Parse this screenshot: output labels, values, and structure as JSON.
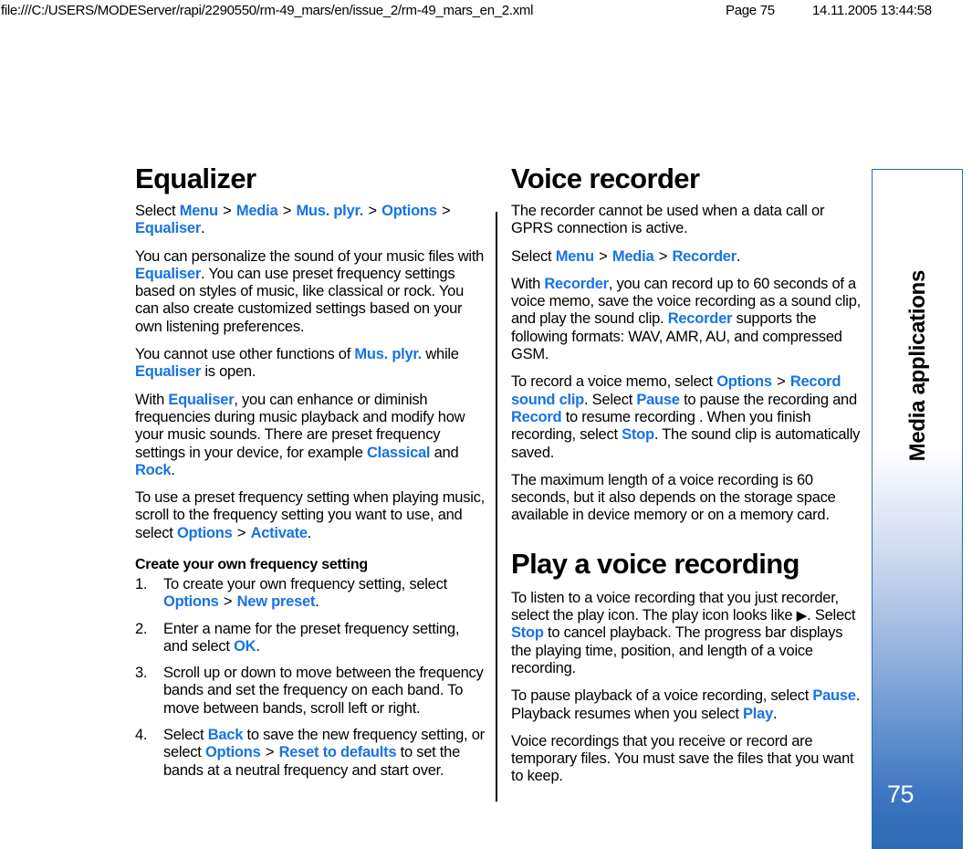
{
  "print_header": {
    "url": "file:///C:/USERS/MODEServer/rapi/2290550/rm-49_mars/en/issue_2/rm-49_mars_en_2.xml",
    "page_label": "Page 75",
    "timestamp": "14.11.2005 13:44:58"
  },
  "colors": {
    "link": "#1773e3",
    "tab_blue": "#3b73bf",
    "tab_border": "#2b6cb0",
    "text": "#000000"
  },
  "sidebar": {
    "chapter_label": "Media applications",
    "page_number": "75"
  },
  "left_column": {
    "title": "Equalizer",
    "paragraphs": {
      "p1": {
        "pre": "Select ",
        "l1": "Menu",
        "l2": "Media",
        "l3": "Mus. plyr.",
        "l4": "Options",
        "l5": "Equaliser",
        "post": "."
      },
      "p2": {
        "t1": "You can personalize the sound of your music files with ",
        "l1": "Equaliser",
        "t2": ". You can use preset frequency settings based on styles of music, like classical or rock. You can also create customized settings based on your own listening preferences."
      },
      "p3": {
        "t1": "You cannot use other functions of ",
        "l1": "Mus. plyr.",
        "t2": " while ",
        "l2": "Equaliser",
        "t3": " is open."
      },
      "p4": {
        "t1": "With ",
        "l1": "Equaliser",
        "t2": ", you can enhance or diminish frequencies during music playback and modify how your music sounds. There are preset frequency settings in your device, for example ",
        "l2": "Classical",
        "t3": " and ",
        "l3": "Rock",
        "t4": "."
      },
      "p5": {
        "t1": "To use a preset frequency setting when playing music, scroll to the frequency setting you want to use, and select ",
        "l1": "Options",
        "l2": "Activate",
        "t2": "."
      }
    },
    "subheading": "Create your own frequency setting",
    "steps": [
      {
        "num": "1.",
        "t1": "To create your own frequency setting, select ",
        "l1": "Options",
        "l2": "New preset",
        "t2": "."
      },
      {
        "num": "2.",
        "t1": "Enter a name for the preset frequency setting, and select ",
        "l1": "OK",
        "t2": "."
      },
      {
        "num": "3.",
        "t1": "Scroll up or down to move between the frequency bands and set the frequency on each band. To move between bands, scroll left or right.",
        "l1": "",
        "l2": "",
        "t2": ""
      },
      {
        "num": "4.",
        "t1": "Select ",
        "l1": "Back",
        "t2": " to save the new frequency setting, or select ",
        "l2": "Options",
        "l3": "Reset to defaults",
        "t3": " to set the bands at a neutral frequency and start over."
      }
    ]
  },
  "right_column": {
    "title": "Voice recorder",
    "paragraphs": {
      "p1": "The recorder cannot be used when a data call or GPRS connection is active.",
      "p2": {
        "pre": "Select ",
        "l1": "Menu",
        "l2": "Media",
        "l3": "Recorder",
        "post": "."
      },
      "p3": {
        "t1": "With ",
        "l1": "Recorder",
        "t2": ", you can record up to 60 seconds of a voice memo, save the voice recording as a sound clip, and play the sound clip. ",
        "l2": "Recorder",
        "t3": " supports the following formats: WAV, AMR, AU, and compressed GSM."
      },
      "p4": {
        "t1": "To record a voice memo, select ",
        "l1": "Options",
        "l2": "Record sound clip",
        "t2": ". Select ",
        "l3": "Pause",
        "t3": " to pause the recording and ",
        "l4": "Record",
        "t4": " to resume recording . When you finish recording, select ",
        "l5": "Stop",
        "t5": ". The sound clip is automatically saved."
      },
      "p5": "The maximum length of a voice recording is 60 seconds, but it also depends on the storage space available in device memory or on a memory card."
    },
    "subsection_title": "Play a voice recording",
    "sub_paragraphs": {
      "p1": {
        "t1": "To listen to a voice recording that you just recorder, select the play icon. The play icon looks like ",
        "glyph": "▶",
        "t2": ". Select ",
        "l1": "Stop",
        "t3": " to cancel playback. The progress bar displays the playing time, position, and length of a voice recording."
      },
      "p2": {
        "t1": "To pause playback of a voice recording, select ",
        "l1": "Pause",
        "t2": ". Playback resumes when you select ",
        "l2": "Play",
        "t3": "."
      },
      "p3": "Voice recordings that you receive or record are temporary files. You must save the files that you want to keep."
    }
  }
}
